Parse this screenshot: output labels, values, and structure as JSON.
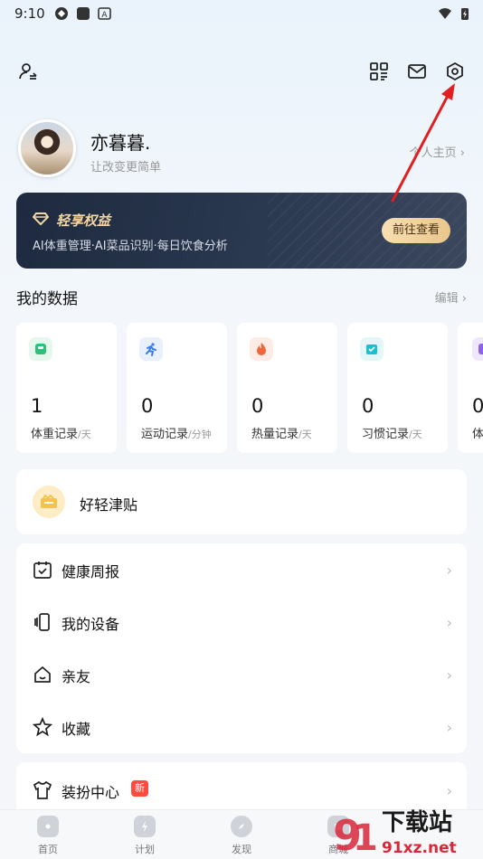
{
  "status": {
    "time": "9:10",
    "battery": "battery-charging-icon",
    "wifi": "wifi-icon"
  },
  "header": {
    "icons": [
      "user-switch-icon",
      "scan-icon",
      "mail-icon",
      "settings-icon"
    ]
  },
  "profile": {
    "name": "亦暮暮.",
    "subtitle": "让改变更简单",
    "link": "个人主页"
  },
  "vip": {
    "title": "轻享权益",
    "desc": "AI体重管理·AI菜品识别·每日饮食分析",
    "button": "前往查看"
  },
  "my_data": {
    "title": "我的数据",
    "edit": "编辑",
    "cards": [
      {
        "value": "1",
        "label": "体重记录",
        "unit": "/天",
        "color": "#2fbf7a",
        "bg": "#e6f7ee"
      },
      {
        "value": "0",
        "label": "运动记录",
        "unit": "/分钟",
        "color": "#3a7be8",
        "bg": "#e8f0fc"
      },
      {
        "value": "0",
        "label": "热量记录",
        "unit": "/天",
        "color": "#f0663c",
        "bg": "#fdece6"
      },
      {
        "value": "0",
        "label": "习惯记录",
        "unit": "/天",
        "color": "#1cbfcf",
        "bg": "#e3f7f9"
      },
      {
        "value": "0",
        "label": "体",
        "unit": "",
        "color": "#8f63e8",
        "bg": "#efe8fc"
      }
    ]
  },
  "tips": {
    "label": "好轻津贴"
  },
  "menu": [
    {
      "label": "健康周报",
      "icon": "calendar-icon"
    },
    {
      "label": "我的设备",
      "icon": "device-icon"
    },
    {
      "label": "亲友",
      "icon": "home-icon"
    },
    {
      "label": "收藏",
      "icon": "star-icon"
    }
  ],
  "menu2": {
    "label": "装扮中心",
    "badge": "新"
  },
  "tabbar": [
    {
      "label": "首页"
    },
    {
      "label": "计划"
    },
    {
      "label": "发现"
    },
    {
      "label": "商城"
    }
  ],
  "watermark": {
    "text1": "下载站",
    "text2": "91xz.net"
  }
}
